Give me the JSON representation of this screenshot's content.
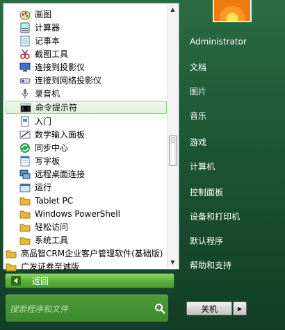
{
  "programs": [
    {
      "label": "画图",
      "icon": "paint-icon"
    },
    {
      "label": "计算器",
      "icon": "calculator-icon"
    },
    {
      "label": "记事本",
      "icon": "notepad-icon"
    },
    {
      "label": "截图工具",
      "icon": "snipping-tool-icon"
    },
    {
      "label": "连接到投影仪",
      "icon": "projector-icon"
    },
    {
      "label": "连接到网络投影仪",
      "icon": "network-projector-icon"
    },
    {
      "label": "录音机",
      "icon": "microphone-icon"
    },
    {
      "label": "命令提示符",
      "icon": "cmd-icon",
      "selected": true
    },
    {
      "label": "入门",
      "icon": "getting-started-icon"
    },
    {
      "label": "数学输入面板",
      "icon": "math-input-icon"
    },
    {
      "label": "同步中心",
      "icon": "sync-center-icon"
    },
    {
      "label": "写字板",
      "icon": "wordpad-icon"
    },
    {
      "label": "远程桌面连接",
      "icon": "remote-desktop-icon"
    },
    {
      "label": "运行",
      "icon": "run-icon"
    },
    {
      "label": "Tablet PC",
      "icon": "folder-icon"
    },
    {
      "label": "Windows PowerShell",
      "icon": "folder-icon"
    },
    {
      "label": "轻松访问",
      "icon": "folder-icon"
    },
    {
      "label": "系统工具",
      "icon": "folder-icon"
    },
    {
      "label": "高品智CRM企业客户管理软件(基础版)",
      "icon": "folder-icon"
    },
    {
      "label": "广发证券至诚版",
      "icon": "folder-icon"
    }
  ],
  "back_label": "返回",
  "search": {
    "placeholder": "搜索程序和文件"
  },
  "right_menu": [
    {
      "label": "Administrator"
    },
    {
      "label": "文档"
    },
    {
      "label": "图片"
    },
    {
      "label": "音乐"
    },
    {
      "label": "游戏"
    },
    {
      "label": "计算机"
    },
    {
      "label": "控制面板"
    },
    {
      "label": "设备和打印机"
    },
    {
      "label": "默认程序"
    },
    {
      "label": "帮助和支持"
    }
  ],
  "power": {
    "shutdown_label": "关机",
    "more_glyph": "▸"
  },
  "colors": {
    "panel_green": "#1f5a36",
    "highlight": "#dff2da",
    "back_button": "#5fb13d"
  }
}
